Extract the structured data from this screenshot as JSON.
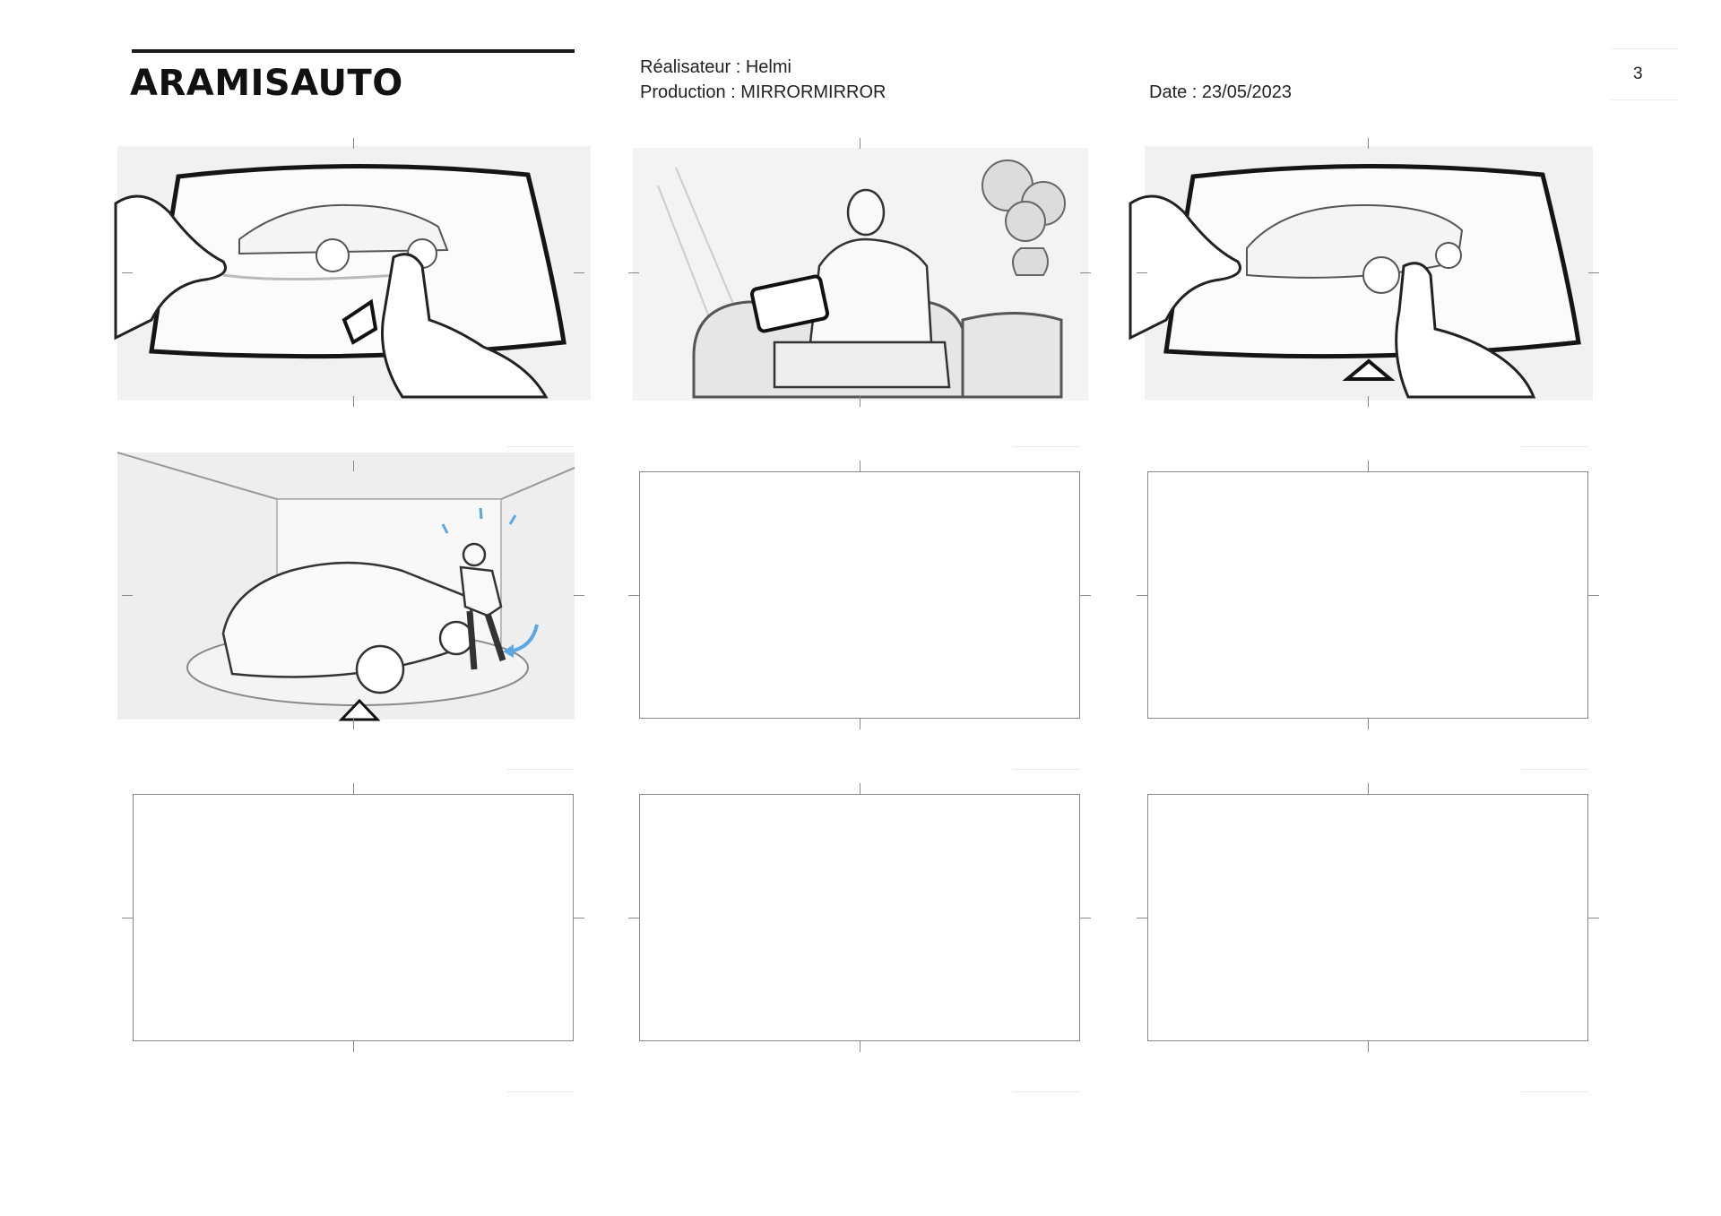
{
  "header": {
    "brand": "ARAMISAUTO",
    "director": "Réalisateur : Helmi",
    "production": "Production : MIRRORMIRROR",
    "date": "Date : 23/05/2023",
    "page_number": "3"
  },
  "panels": [
    {
      "id": 1,
      "content": "sketch",
      "scene": "hands pinching a car image on a tablet screen"
    },
    {
      "id": 2,
      "content": "sketch",
      "scene": "man seated on a sofa holding a tablet"
    },
    {
      "id": 3,
      "content": "sketch",
      "scene": "finger rotating a car image on a tablet screen"
    },
    {
      "id": 4,
      "content": "sketch",
      "scene": "car on a turntable with a man walking around it"
    },
    {
      "id": 5,
      "content": "empty"
    },
    {
      "id": 6,
      "content": "empty"
    },
    {
      "id": 7,
      "content": "empty"
    },
    {
      "id": 8,
      "content": "empty"
    },
    {
      "id": 9,
      "content": "empty"
    }
  ],
  "colors": {
    "ink": "#1a1a1a",
    "frame_border": "#8a8a8a",
    "sketch_gray": "#9a9a9a",
    "accent_blue": "#5aa7e3"
  }
}
